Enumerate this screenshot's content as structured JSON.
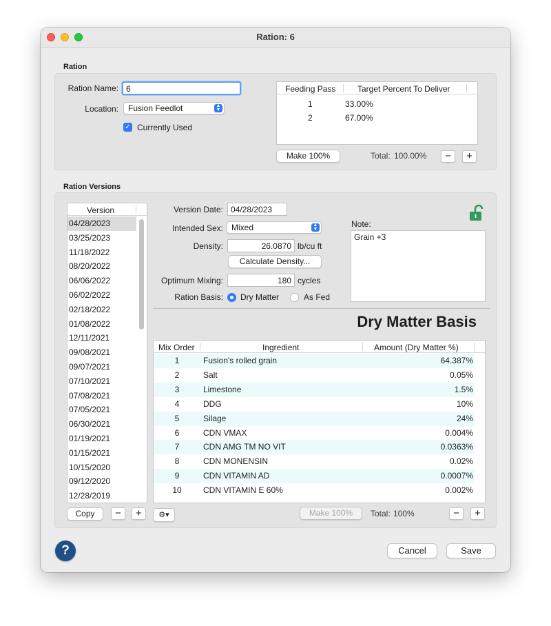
{
  "window": {
    "title": "Ration: 6"
  },
  "ration": {
    "section_label": "Ration",
    "name_label": "Ration Name:",
    "name_value": "6",
    "location_label": "Location:",
    "location_value": "Fusion Feedlot",
    "currently_used_label": "Currently Used",
    "currently_used_checked": true,
    "passes_table": {
      "headers": [
        "Feeding Pass",
        "Target Percent To Deliver"
      ],
      "rows": [
        {
          "pass": "1",
          "percent": "33.00%"
        },
        {
          "pass": "2",
          "percent": "67.00%"
        }
      ]
    },
    "make100_label": "Make 100%",
    "total_label": "Total:",
    "total_value": "100.00%",
    "minus": "−",
    "plus": "+"
  },
  "versions": {
    "section_label": "Ration Versions",
    "list_header": "Version",
    "list": [
      "04/28/2023",
      "03/25/2023",
      "11/18/2022",
      "08/20/2022",
      "06/06/2022",
      "06/02/2022",
      "02/18/2022",
      "01/08/2022",
      "12/11/2021",
      "09/08/2021",
      "09/07/2021",
      "07/10/2021",
      "07/08/2021",
      "07/05/2021",
      "06/30/2021",
      "01/19/2021",
      "01/15/2021",
      "10/15/2020",
      "09/12/2020",
      "12/28/2019"
    ],
    "copy_label": "Copy",
    "minus": "−",
    "plus": "+",
    "detail": {
      "version_date_label": "Version Date:",
      "version_date_value": "04/28/2023",
      "intended_sex_label": "Intended Sex:",
      "intended_sex_value": "Mixed",
      "density_label": "Density:",
      "density_value": "26.0870",
      "density_unit": "lb/cu ft",
      "calc_density_label": "Calculate Density...",
      "mixing_label": "Optimum Mixing:",
      "mixing_value": "180",
      "mixing_unit": "cycles",
      "basis_label": "Ration Basis:",
      "basis_options": [
        "Dry Matter",
        "As Fed"
      ],
      "basis_selected": "Dry Matter",
      "note_label": "Note:",
      "note_value": "Grain +3",
      "basis_heading": "Dry Matter Basis"
    },
    "ingredients": {
      "headers": [
        "Mix Order",
        "Ingredient",
        "Amount (Dry Matter %)"
      ],
      "rows": [
        {
          "order": "1",
          "name": "Fusion's rolled grain",
          "amount": "64.387%"
        },
        {
          "order": "2",
          "name": "Salt",
          "amount": "0.05%"
        },
        {
          "order": "3",
          "name": "Limestone",
          "amount": "1.5%"
        },
        {
          "order": "4",
          "name": "DDG",
          "amount": "10%"
        },
        {
          "order": "5",
          "name": "Silage",
          "amount": "24%"
        },
        {
          "order": "6",
          "name": "CDN VMAX",
          "amount": "0.004%"
        },
        {
          "order": "7",
          "name": "CDN AMG TM NO VIT",
          "amount": "0.0363%"
        },
        {
          "order": "8",
          "name": "CDN MONENSIN",
          "amount": "0.02%"
        },
        {
          "order": "9",
          "name": "CDN VITAMIN AD",
          "amount": "0.0007%"
        },
        {
          "order": "10",
          "name": "CDN VITAMIN E 60%",
          "amount": "0.002%"
        }
      ],
      "make100_label": "Make 100%",
      "total_label": "Total:",
      "total_value": "100%",
      "gear_caret": "▾",
      "minus": "−",
      "plus": "+"
    }
  },
  "footer": {
    "help": "?",
    "cancel_label": "Cancel",
    "save_label": "Save"
  },
  "colors": {
    "accent": "#2f7cf6",
    "alt_row": "#ebfbfb",
    "help": "#1f4f86",
    "lock": "#2f9a5a"
  }
}
